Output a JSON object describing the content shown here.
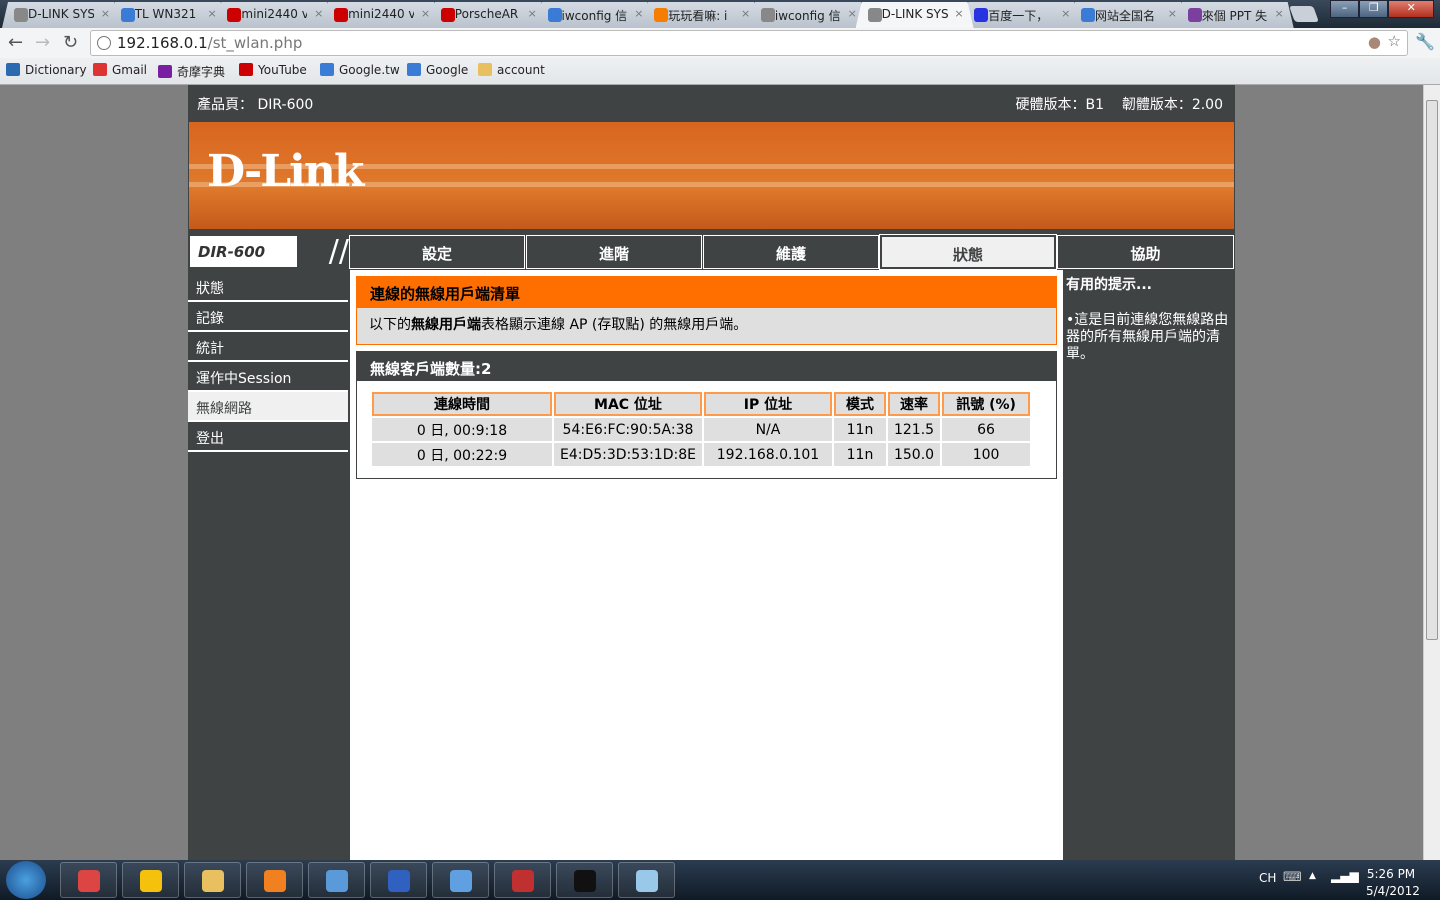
{
  "browser": {
    "tabs": [
      {
        "title": "D-LINK SYS",
        "icon": "globe-icon",
        "color": "#888"
      },
      {
        "title": "TL WN321",
        "icon": "google-icon",
        "color": "#3a7bd5"
      },
      {
        "title": "mini2440 v",
        "icon": "youtube-icon",
        "color": "#c00"
      },
      {
        "title": "mini2440 v",
        "icon": "youtube-icon",
        "color": "#c00"
      },
      {
        "title": "PorscheAR",
        "icon": "youtube-icon",
        "color": "#c00"
      },
      {
        "title": "iwconfig 信",
        "icon": "google-icon",
        "color": "#3a7bd5"
      },
      {
        "title": "玩玩看嘛: i",
        "icon": "blogger-icon",
        "color": "#f57d00"
      },
      {
        "title": "iwconfig 信",
        "icon": "globe-icon",
        "color": "#888"
      },
      {
        "title": "D-LINK SYS",
        "icon": "globe-icon",
        "color": "#888",
        "active": true
      },
      {
        "title": "百度一下，",
        "icon": "baidu-icon",
        "color": "#2932e1"
      },
      {
        "title": "网站全国名",
        "icon": "google-icon",
        "color": "#3a7bd5"
      },
      {
        "title": "來個 PPT 失",
        "icon": "ppt-icon",
        "color": "#7b3fa0"
      }
    ],
    "url_host": "192.168.0.1",
    "url_path": "/st_wlan.php",
    "bookmarks": [
      {
        "label": "Dictionary",
        "color": "#2a6ab0"
      },
      {
        "label": "Gmail",
        "color": "#d33"
      },
      {
        "label": "奇摩字典",
        "color": "#7b1fa2"
      },
      {
        "label": "YouTube",
        "color": "#c00"
      },
      {
        "label": "Google.tw",
        "color": "#3a7bd5"
      },
      {
        "label": "Google",
        "color": "#3a7bd5"
      },
      {
        "label": "account",
        "color": "#e8c060"
      }
    ]
  },
  "router": {
    "product": "產品頁： DIR-600",
    "hw_version": "硬體版本：B1",
    "fw_version": "韌體版本：2.00",
    "logo": "D-Link",
    "model_badge": "DIR-600",
    "nav": [
      "設定",
      "進階",
      "維護",
      "狀態",
      "協助"
    ],
    "sidebar": [
      "狀態",
      "記錄",
      "統計",
      "運作中Session",
      "無線網路",
      "登出"
    ],
    "section_title": "連線的無線用戶端清單",
    "desc_pre": "以下的",
    "desc_bold": "無線用戶端",
    "desc_post": "表格顯示連線 AP (存取點) 的無線用戶端。",
    "count_title": "無線客戶端數量:2",
    "table": {
      "headers": [
        "連線時間",
        "MAC 位址",
        "IP 位址",
        "模式",
        "速率",
        "訊號 (%)"
      ],
      "rows": [
        [
          "0 日, 00:9:18",
          "54:E6:FC:90:5A:38",
          "N/A",
          "11n",
          "121.5",
          "66"
        ],
        [
          "0 日, 00:22:9",
          "E4:D5:3D:53:1D:8E",
          "192.168.0.101",
          "11n",
          "150.0",
          "100"
        ]
      ]
    },
    "help_title": "有用的提示...",
    "help_text": "•這是目前連線您無線路由器的所有無線用戶端的清單。"
  },
  "taskbar": {
    "apps": [
      {
        "name": "chrome",
        "color": "#d44"
      },
      {
        "name": "app-yellow",
        "color": "#f4c20d"
      },
      {
        "name": "explorer",
        "color": "#e8c060"
      },
      {
        "name": "media-player",
        "color": "#f08020"
      },
      {
        "name": "control-panel",
        "color": "#5a9ad8"
      },
      {
        "name": "network-tool",
        "color": "#3060c0"
      },
      {
        "name": "paint",
        "color": "#60a0e0"
      },
      {
        "name": "toolbox",
        "color": "#c03030"
      },
      {
        "name": "cmd",
        "color": "#111"
      },
      {
        "name": "notes",
        "color": "#9ac8e8"
      }
    ],
    "lang": "CH",
    "time": "5:26 PM",
    "date": "5/4/2012"
  }
}
